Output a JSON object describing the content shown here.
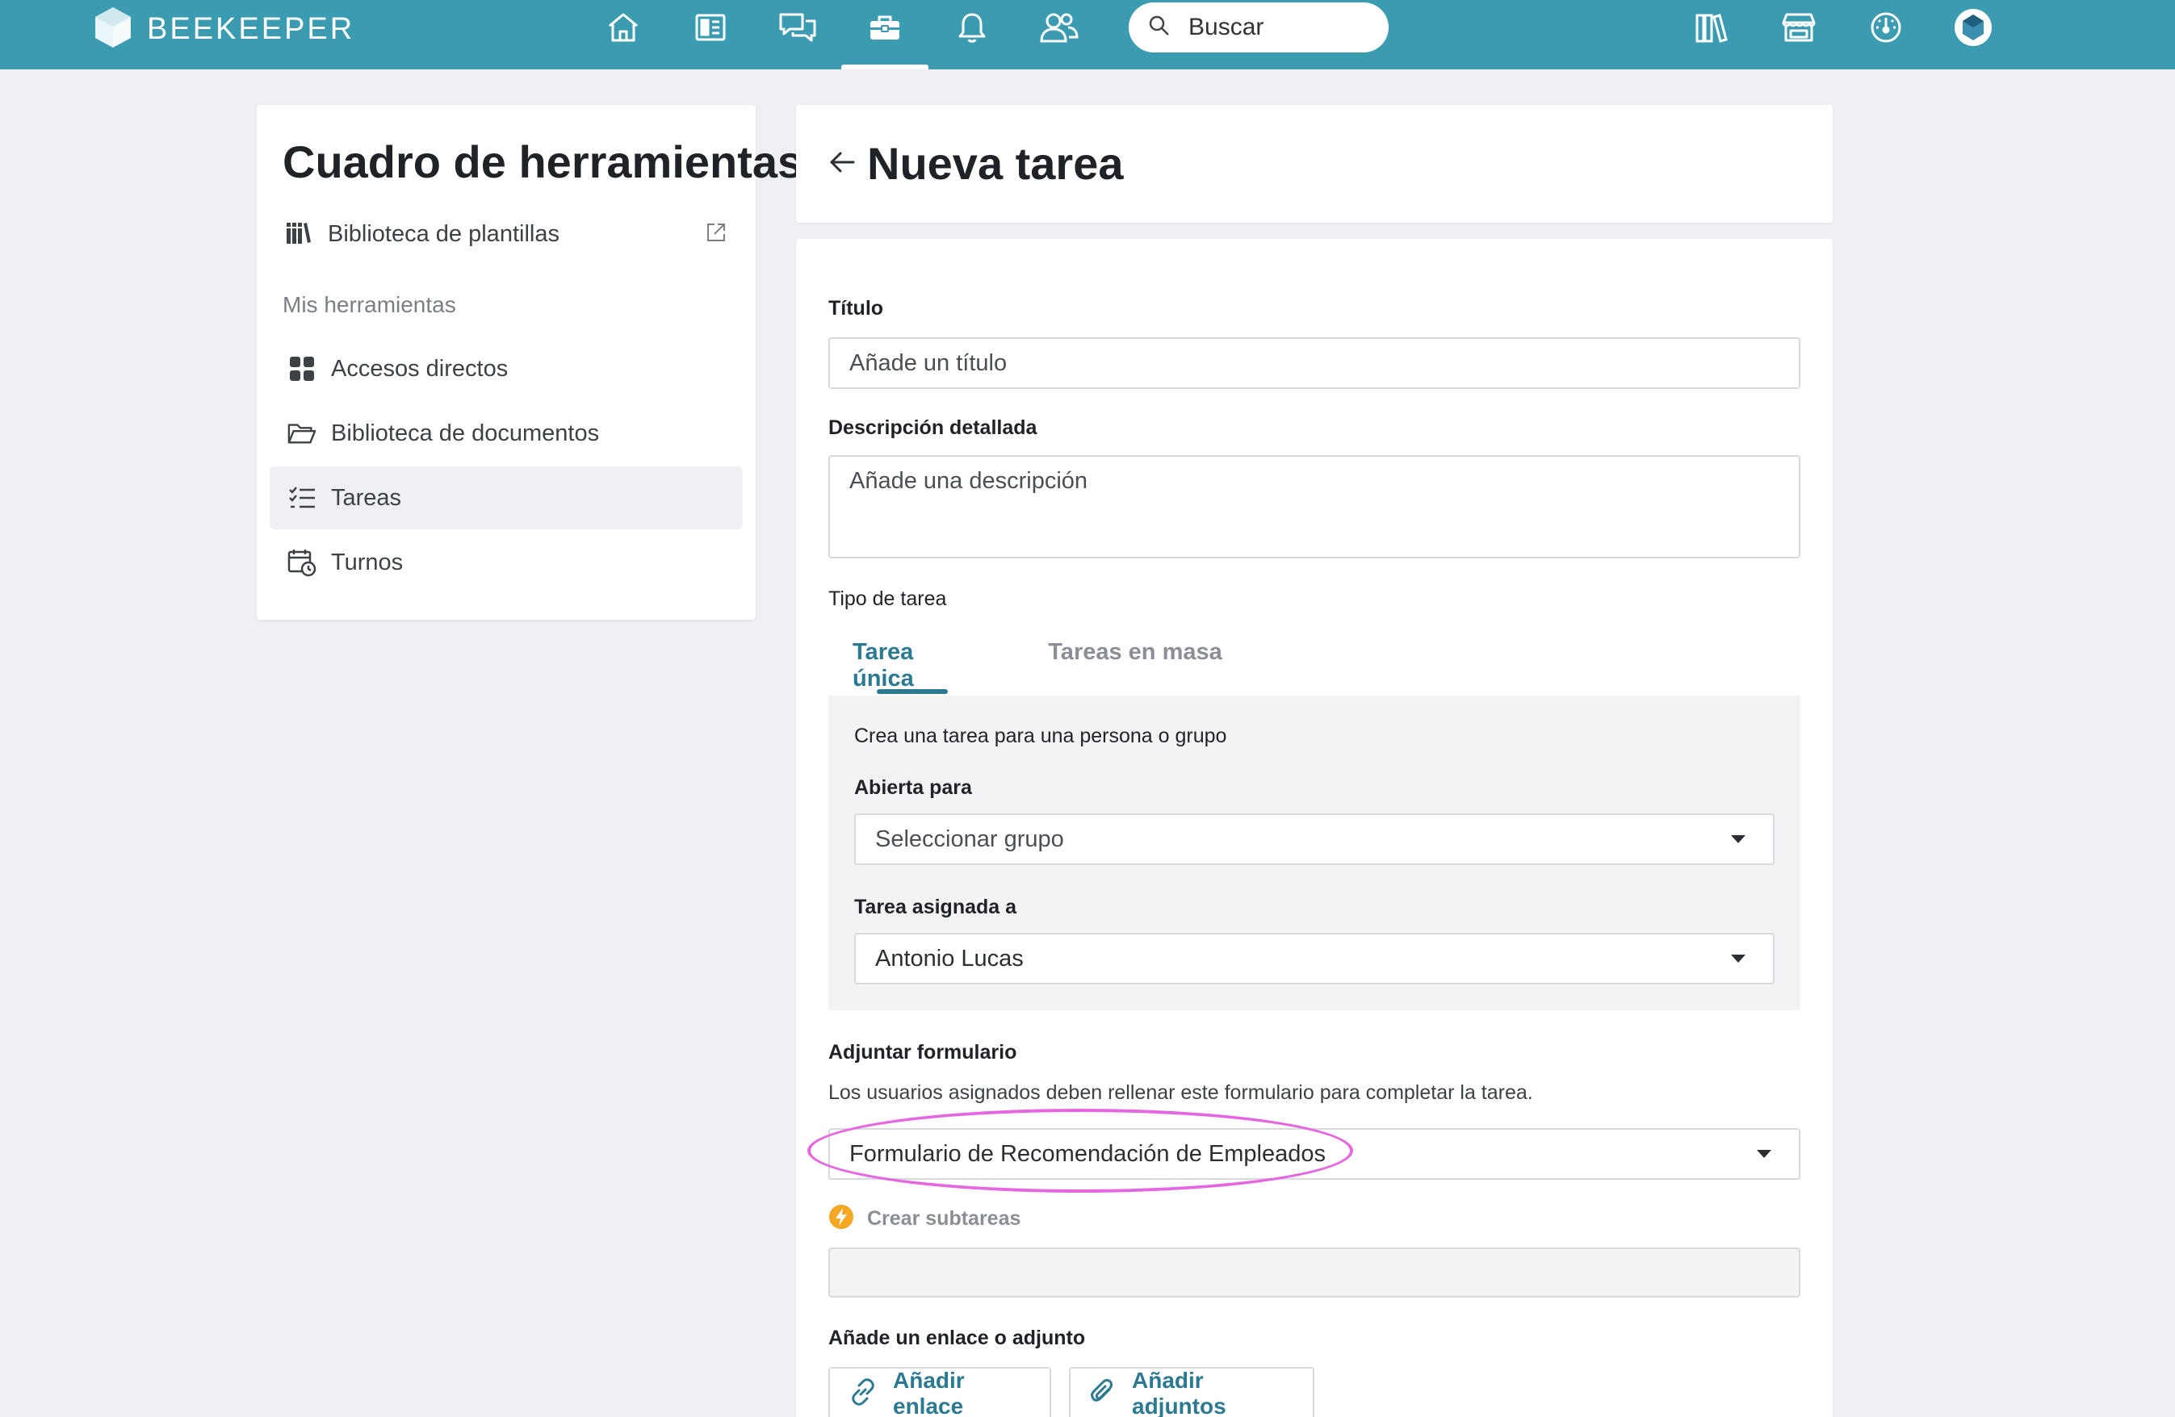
{
  "brand": {
    "name": "BEEKEEPER"
  },
  "search": {
    "placeholder": "Buscar"
  },
  "nav_icons": [
    "home-icon",
    "news-icon",
    "chat-icon",
    "toolbox-icon",
    "bell-icon",
    "people-icon"
  ],
  "right_icons": [
    "books-icon",
    "store-icon",
    "dashboard-icon",
    "avatar"
  ],
  "sidebar": {
    "title": "Cuadro de herramientas",
    "library_link": "Biblioteca de plantillas",
    "section_label": "Mis herramientas",
    "items": [
      {
        "label": "Accesos directos",
        "icon": "grid-icon"
      },
      {
        "label": "Biblioteca de documentos",
        "icon": "folder-icon"
      },
      {
        "label": "Tareas",
        "icon": "tasks-icon",
        "active": true
      },
      {
        "label": "Turnos",
        "icon": "calendar-clock-icon"
      }
    ]
  },
  "header": {
    "title": "Nueva tarea"
  },
  "form": {
    "title_label": "Título",
    "title_placeholder": "Añade un título",
    "description_label": "Descripción detallada",
    "description_placeholder": "Añade una descripción",
    "task_type_label": "Tipo de tarea",
    "tabs": [
      {
        "label": "Tarea única",
        "active": true
      },
      {
        "label": "Tareas en masa",
        "active": false
      }
    ],
    "single_task_desc": "Crea una tarea para una persona o grupo",
    "open_for_label": "Abierta para",
    "open_for_value": "Seleccionar grupo",
    "assigned_to_label": "Tarea asignada a",
    "assigned_to_value": "Antonio Lucas",
    "attach_form_label": "Adjuntar formulario",
    "attach_form_desc": "Los usuarios asignados deben rellenar este formulario para completar la tarea.",
    "attach_form_value": "Formulario de Recomendación de Empleados",
    "subtasks_label": "Crear subtareas",
    "link_attachment_label": "Añade un enlace o adjunto",
    "add_link_button": "Añadir enlace",
    "add_attachments_button": "Añadir adjuntos"
  },
  "colors": {
    "topbar": "#3a9bb1",
    "accent": "#2b7a91",
    "highlight": "#e566e0",
    "bolt_badge": "#f5a623"
  }
}
